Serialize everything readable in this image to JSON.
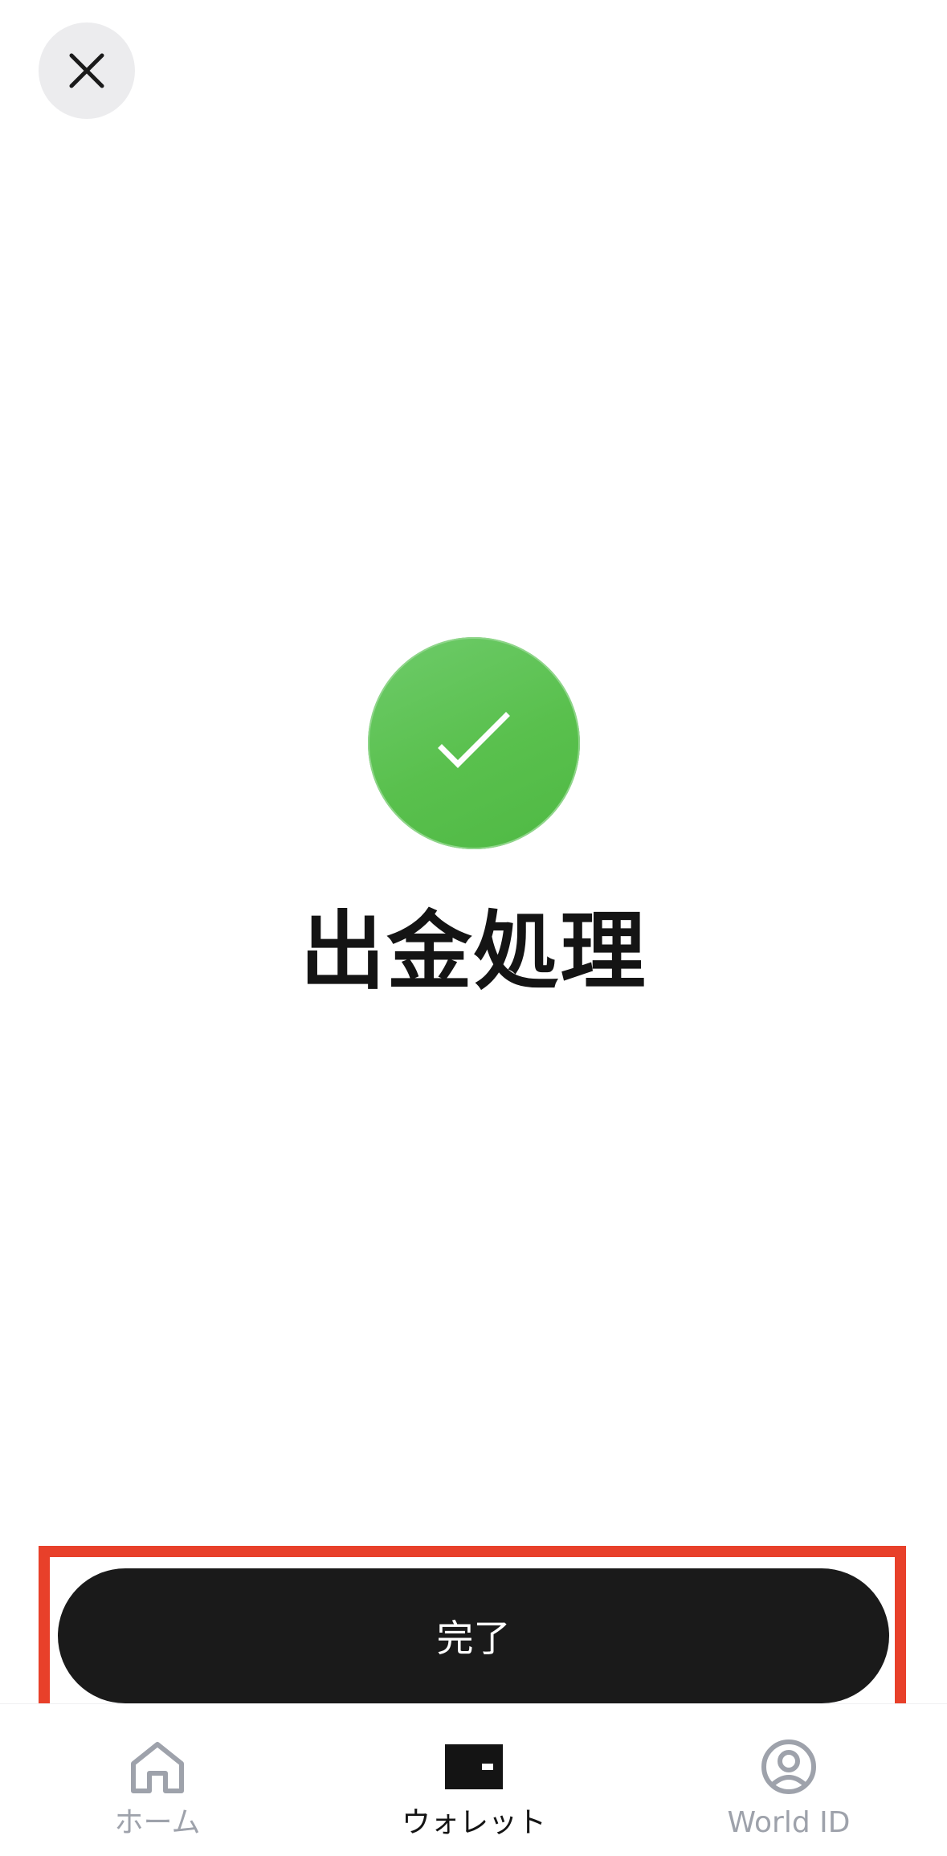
{
  "header": {
    "close_icon": "close-icon"
  },
  "status": {
    "icon": "checkmark-icon",
    "color": "#59c04d",
    "title": "出金処理"
  },
  "actions": {
    "done_label": "完了",
    "highlight_color": "#e8402a"
  },
  "tabbar": {
    "items": [
      {
        "label": "ホーム",
        "icon": "home-icon",
        "active": false
      },
      {
        "label": "ウォレット",
        "icon": "wallet-icon",
        "active": true
      },
      {
        "label": "World ID",
        "icon": "user-circle-icon",
        "active": false
      }
    ]
  }
}
